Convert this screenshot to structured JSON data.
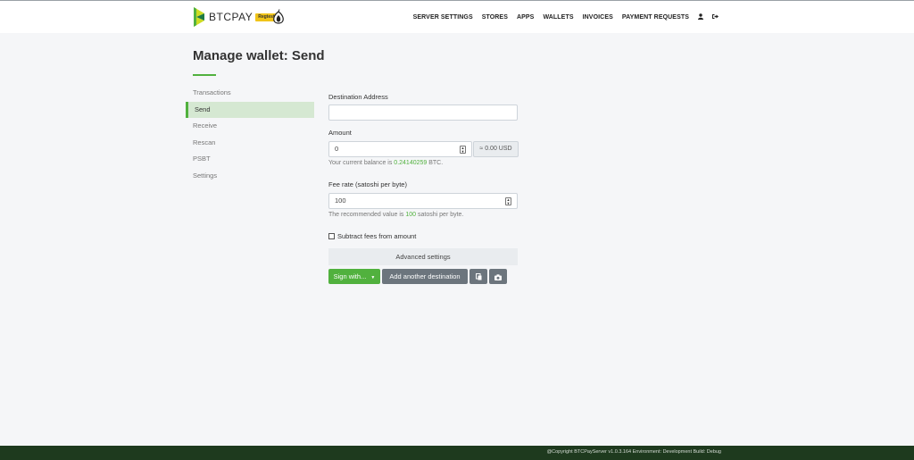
{
  "brand": {
    "name": "BTCPAY",
    "badge": "Regtest"
  },
  "nav": {
    "items": [
      "SERVER SETTINGS",
      "STORES",
      "APPS",
      "WALLETS",
      "INVOICES",
      "PAYMENT REQUESTS"
    ],
    "account_icon": "user-icon",
    "logout_icon": "logout-icon"
  },
  "page": {
    "title": "Manage wallet: Send"
  },
  "sidebar": {
    "items": [
      {
        "label": "Transactions"
      },
      {
        "label": "Send",
        "active": true
      },
      {
        "label": "Receive"
      },
      {
        "label": "Rescan"
      },
      {
        "label": "PSBT"
      },
      {
        "label": "Settings"
      }
    ]
  },
  "form": {
    "destination_label": "Destination Address",
    "destination_value": "",
    "amount_label": "Amount",
    "amount_value": "0",
    "amount_fiat": "≈ 0.00 USD",
    "balance_prefix": "Your current balance is",
    "balance_value": "0.24140259",
    "balance_suffix": "BTC.",
    "fee_label": "Fee rate (satoshi per byte)",
    "fee_value": "100",
    "fee_help_prefix": "The recommended value is",
    "fee_help_value": "100",
    "fee_help_suffix": "satoshi per byte.",
    "subtract_fees_label": "Subtract fees from amount",
    "subtract_fees_checked": false,
    "advanced_label": "Advanced settings",
    "sign_button": "Sign with...",
    "add_destination_button": "Add another destination",
    "paste_icon": "clipboard-icon",
    "camera_icon": "camera-icon"
  },
  "footer": {
    "text": "@Copyright BTCPayServer v1.0.3.164 Environment: Development Build: Debug"
  },
  "colors": {
    "accent": "#51b13e",
    "footer_bg": "#1e3a1e",
    "active_bg": "#d5e8d2",
    "badge": "#f0c419"
  }
}
